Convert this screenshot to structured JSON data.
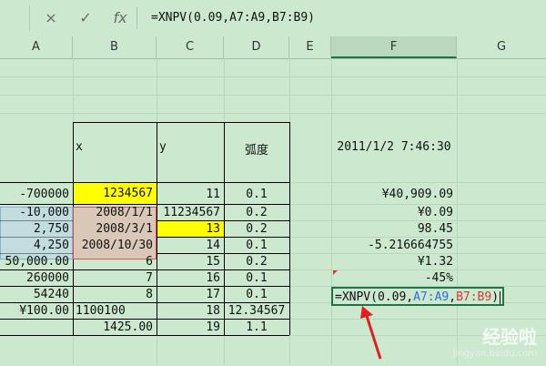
{
  "formula_bar": {
    "cancel_icon": "×",
    "enter_icon": "✓",
    "fx_label": "fx",
    "formula": "=XNPV(0.09,A7:A9,B7:B9)"
  },
  "columns": [
    "A",
    "B",
    "C",
    "D",
    "E",
    "F",
    "G"
  ],
  "headers": {
    "x": "x",
    "y": "y",
    "arc": "弧度",
    "datetime": "2011/1/2 7:46:30"
  },
  "rows": [
    {
      "a": "-700000",
      "b": "1234567",
      "c": "11",
      "d": "0.1",
      "f": "¥40,909.09"
    },
    {
      "a": "-10,000",
      "b": "2008/1/1",
      "c": "11234567",
      "d": "0.2",
      "f": "¥0.09"
    },
    {
      "a": "2,750",
      "b": "2008/3/1",
      "c": "13",
      "d": "0.2",
      "f": "98.45"
    },
    {
      "a": "4,250",
      "b": "2008/10/30",
      "c": "14",
      "d": "0.1",
      "f": "-5.216664755"
    },
    {
      "a": "50,000.00",
      "b": "6",
      "c": "15",
      "d": "0.2",
      "f": "¥1.32"
    },
    {
      "a": "260000",
      "b": "7",
      "c": "16",
      "d": "0.1",
      "f": "-45%"
    },
    {
      "a": "54240",
      "b": "8",
      "c": "17",
      "d": "0.1",
      "f": ""
    },
    {
      "a": "¥100.00",
      "b": "1100100",
      "c": "18",
      "d": "12.34567",
      "f": ""
    },
    {
      "a": "",
      "b": "1425.00",
      "c": "19",
      "d": "1.1",
      "f": ""
    }
  ],
  "editing_cell": {
    "part1": "=XNPV(0.09,",
    "part2": "A7:A9",
    "part3": ",",
    "part4": "B7:B9",
    "part5": ")"
  },
  "watermark": "经验啦",
  "watermark_sub": "jingyan.baidu.com",
  "colors": {
    "sheet_bg": "#cce8cf",
    "yellow": "#ffff00",
    "ref_blue": "#2f6fd6",
    "ref_red": "#d33b3b",
    "accent_green": "#217346"
  }
}
